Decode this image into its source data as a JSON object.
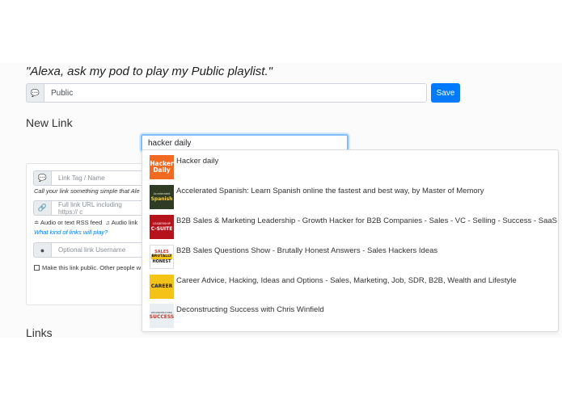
{
  "quote": "\"Alexa, ask my pod to play my Public playlist.\"",
  "playlist": {
    "icon": "speech-icon",
    "value": "Public",
    "save_label": "Save"
  },
  "new_link": {
    "heading": "New Link",
    "search_value": "hacker daily",
    "tag_placeholder": "Link Tag / Name",
    "tag_help": "Call your link something simple that Ale",
    "url_placeholder": "Full link URL including https:// c",
    "feed_note_rss": "Audio or text RSS feed",
    "feed_note_audio": "Audio link",
    "links_help": "What kind of links will play?",
    "username_placeholder": "Optional link Username",
    "public_text": "Make this link public. Other people w"
  },
  "links_heading": "Links",
  "dropdown": {
    "items": [
      {
        "title": "Hacker daily",
        "thumb": {
          "lines": [
            "Hacker",
            "Daily"
          ],
          "bg": "#f26a21",
          "fg": "#ffffff"
        }
      },
      {
        "title": "Accelerated Spanish: Learn Spanish online the fastest and best way, by Master of Memory",
        "thumb": {
          "lines": [
            "Accelerated",
            "Spanish"
          ],
          "bg": "#2f3b24",
          "fg": "#f2d24a"
        }
      },
      {
        "title": "B2B Sales & Marketing Leadership - Growth Hacker for B2B Companies - Sales - VC - Selling - Success - SaaS",
        "thumb": {
          "lines": [
            "LEADERSHIP",
            "C-SUITE"
          ],
          "bg": "#b5121b",
          "fg": "#ffffff"
        }
      },
      {
        "title": "B2B Sales Questions Show - Brutally Honest Answers - Sales Hackers Ideas",
        "thumb": {
          "lines": [
            "SALES",
            "BRUTALLY",
            "HONEST"
          ],
          "bg": "#ffffff",
          "fg": "#1a1a1a"
        }
      },
      {
        "title": "Career Advice, Hacking, Ideas and Options - Sales, Marketing, Job, SDR, B2B, Wealth and Lifestyle",
        "thumb": {
          "lines": [
            "CAREER"
          ],
          "bg": "#f3c317",
          "fg": "#222222"
        }
      },
      {
        "title": "Deconstructing Success with Chris Winfield",
        "thumb": {
          "lines": [
            "DECONSTRUCTING",
            "SUCCESS"
          ],
          "bg": "#e9eef2",
          "fg": "#c0392b"
        }
      }
    ]
  },
  "colors": {
    "primary": "#007bff",
    "focus_border": "#80bdff"
  }
}
